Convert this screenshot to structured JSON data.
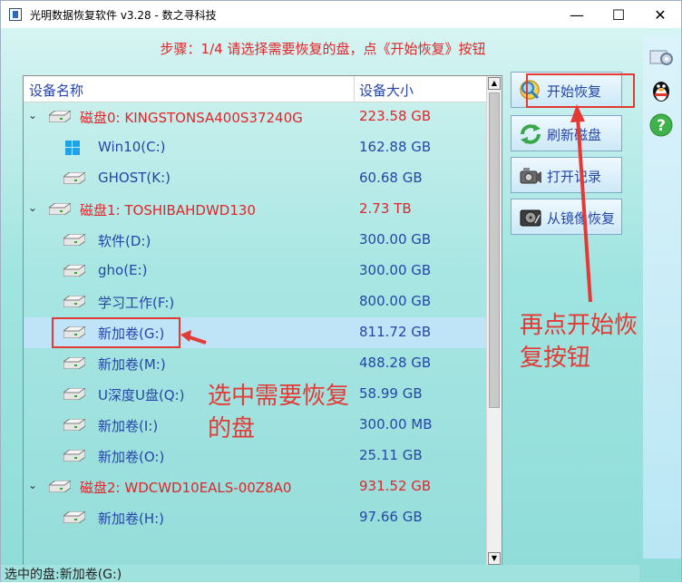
{
  "window": {
    "title": "光明数据恢复软件 v3.28 - 数之寻科技",
    "controls": [
      "—",
      "☐",
      "✕"
    ]
  },
  "step_text": "步骤：1/4 请选择需要恢复的盘，点《开始恢复》按钮",
  "list": {
    "col_name": "设备名称",
    "col_size": "设备大小",
    "rows": [
      {
        "name": "磁盘0: KINGSTONSA400S37240G",
        "size": "223.58 GB",
        "level": 0,
        "color": "red",
        "icon": "disk"
      },
      {
        "name": "Win10(C:)",
        "size": "162.88 GB",
        "level": 1,
        "color": "blue",
        "icon": "windows"
      },
      {
        "name": "GHOST(K:)",
        "size": "60.68 GB",
        "level": 1,
        "color": "blue",
        "icon": "disk"
      },
      {
        "name": "磁盘1: TOSHIBAHDWD130",
        "size": "2.73 TB",
        "level": 0,
        "color": "red",
        "icon": "disk"
      },
      {
        "name": " 软件(D:)",
        "size": "300.00 GB",
        "level": 1,
        "color": "blue",
        "icon": "disk"
      },
      {
        "name": "gho(E:)",
        "size": "300.00 GB",
        "level": 1,
        "color": "blue",
        "icon": "disk"
      },
      {
        "name": "学习工作(F:)",
        "size": "800.00 GB",
        "level": 1,
        "color": "blue",
        "icon": "disk"
      },
      {
        "name": "新加卷(G:)",
        "size": "811.72 GB",
        "level": 1,
        "color": "blue",
        "icon": "disk",
        "selected": true
      },
      {
        "name": "新加卷(M:)",
        "size": "488.28 GB",
        "level": 1,
        "color": "blue",
        "icon": "disk"
      },
      {
        "name": "U深度U盘(Q:)",
        "size": "58.99 GB",
        "level": 1,
        "color": "blue",
        "icon": "disk"
      },
      {
        "name": "新加卷(I:)",
        "size": "300.00 MB",
        "level": 1,
        "color": "blue",
        "icon": "disk"
      },
      {
        "name": "新加卷(O:)",
        "size": "25.11 GB",
        "level": 1,
        "color": "blue",
        "icon": "disk"
      },
      {
        "name": "磁盘2: WDCWD10EALS-00Z8A0",
        "size": "931.52 GB",
        "level": 0,
        "color": "red",
        "icon": "disk"
      },
      {
        "name": "新加卷(H:)",
        "size": "97.66 GB",
        "level": 1,
        "color": "blue",
        "icon": "disk"
      }
    ]
  },
  "buttons": {
    "start": "开始恢复",
    "refresh": "刷新磁盘",
    "open_record": "打开记录",
    "from_image": "从镜像恢复"
  },
  "status": "选中的盘:新加卷(G:)",
  "annotations": {
    "select_disk_line1": "选中需要恢复",
    "select_disk_line2": "的盘",
    "click_start_line1": "再点开始恢",
    "click_start_line2": "复按钮"
  },
  "colors": {
    "accent_red": "#e0262a",
    "text_blue": "#2546a8",
    "annotation_red": "#e43a36",
    "selected_row": "#bfe3f7"
  }
}
